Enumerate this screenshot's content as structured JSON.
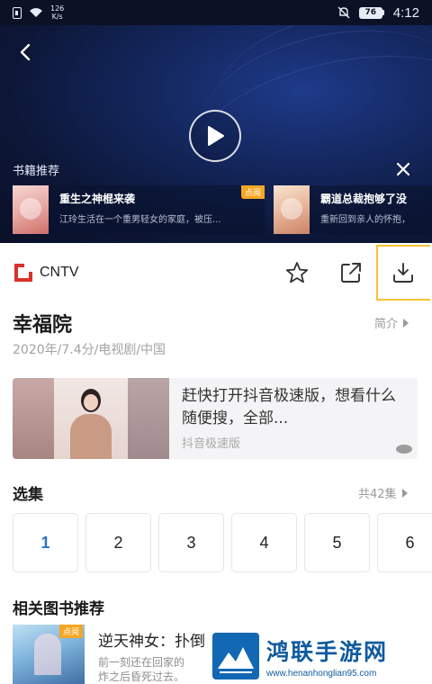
{
  "status_bar": {
    "net_speed_value": "126",
    "net_speed_unit": "K/s",
    "battery": "76",
    "time": "4:12"
  },
  "player": {
    "recommend_title": "书籍推荐",
    "recommendations": [
      {
        "name": "重生之神棍来袭",
        "desc": "江玲生活在一个重男轻女的家庭，被压...",
        "badge": "点阅"
      },
      {
        "name": "霸道总裁抱够了没",
        "desc": "重新回到亲人的怀抱，"
      }
    ]
  },
  "source": {
    "name": "CNTV"
  },
  "show": {
    "title": "幸福院",
    "intro_label": "简介",
    "meta": "2020年/7.4分/电视剧/中国"
  },
  "ad": {
    "text": "赶快打开抖音极速版，想看什么随便搜，全部...",
    "source": "抖音极速版"
  },
  "episodes": {
    "header": "选集",
    "count": "共42集",
    "items": [
      "1",
      "2",
      "3",
      "4",
      "5",
      "6"
    ]
  },
  "related": {
    "title": "相关图书推荐",
    "book": {
      "name": "逆天神女：扑倒",
      "desc_line1": "前一刻还在回家的",
      "desc_line2": "炸之后昏死过去。",
      "badge": "点阅"
    }
  },
  "watermark": {
    "title": "鸿联手游网",
    "url": "www.henanhonglian95.com"
  },
  "colors": {
    "accent_blue": "#2a73c9",
    "badge_orange": "#f5a623",
    "highlight_yellow": "#f6c234",
    "cntv_red": "#d8322a"
  }
}
